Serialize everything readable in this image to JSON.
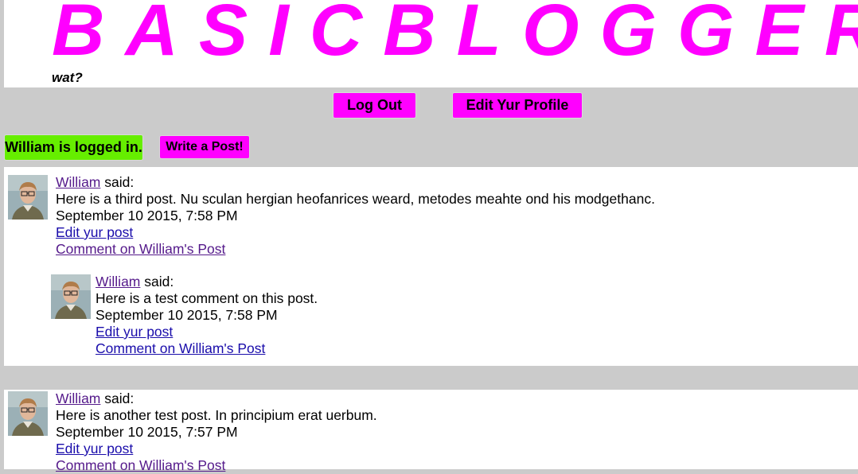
{
  "site": {
    "title": "BASICBLOGGER",
    "tagline": "wat?"
  },
  "nav": {
    "logout_label": "Log Out",
    "edit_profile_label": "Edit Yur Profile"
  },
  "status": {
    "logged_in_text": "William is logged in.",
    "write_post_label": "Write a Post!"
  },
  "posts": [
    {
      "author": "William",
      "said": "said:",
      "body": "Here is a third post. Nu sculan hergian heofanrices weard, metodes meahte ond his modgethanc.",
      "timestamp": "September 10 2015, 7:58 PM",
      "edit_label": "Edit yur post",
      "comment_label": "Comment on William's Post",
      "comments": [
        {
          "author": "William",
          "said": "said:",
          "body": "Here is a test comment on this post.",
          "timestamp": "September 10 2015, 7:58 PM",
          "edit_label": "Edit yur post",
          "comment_label": "Comment on William's Post"
        }
      ]
    },
    {
      "author": "William",
      "said": "said:",
      "body": "Here is another test post. In principium erat uerbum.",
      "timestamp": "September 10 2015, 7:57 PM",
      "edit_label": "Edit yur post",
      "comment_label": "Comment on William's Post"
    }
  ],
  "colors": {
    "brand": "#ff00ff",
    "status_green": "#66ee00",
    "background_gray": "#cbcbcb"
  }
}
